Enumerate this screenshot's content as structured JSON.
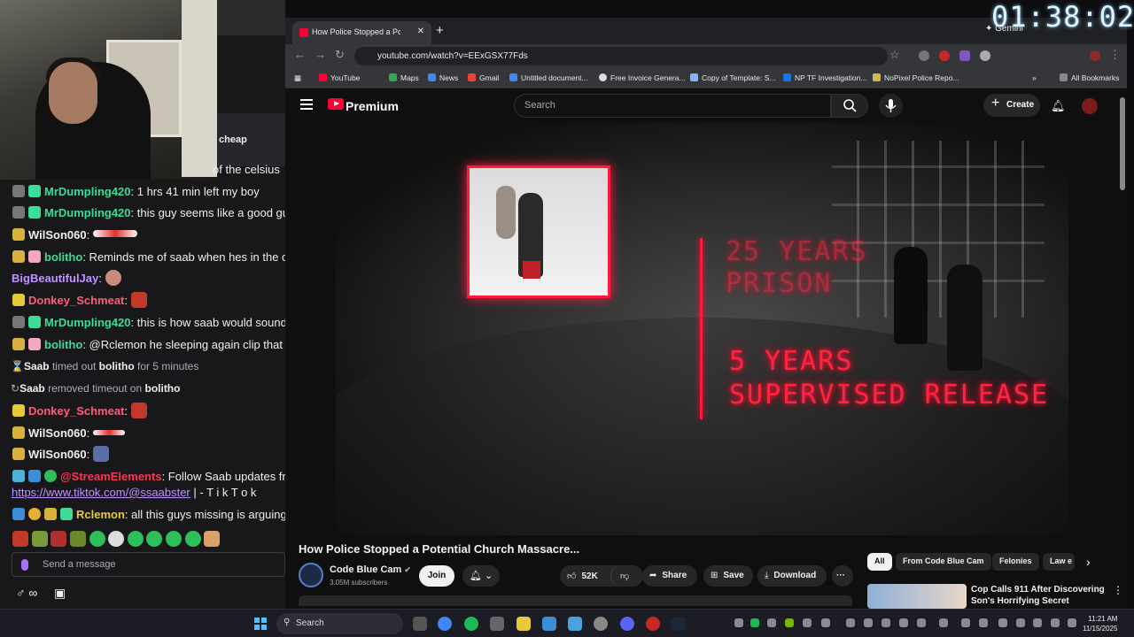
{
  "timer": "01:38:02",
  "chat": {
    "promo_text": "cheap",
    "messages": [
      {
        "user": "",
        "text": "of the celsius",
        "color": "#efeff1"
      },
      {
        "user": "MrDumpling420",
        "text": ": 1 hrs 41 min left my boy",
        "color": "#3ddc97"
      },
      {
        "user": "MrDumpling420",
        "text": ": this guy seems like a good gu",
        "color": "#3ddc97"
      },
      {
        "user": "WilSon060",
        "text": ":",
        "color": "#efeff1"
      },
      {
        "user": "bolitho",
        "text": ": Reminds me of saab when hes in the ca",
        "color": "#3ddc97"
      },
      {
        "user": "BigBeautifulJay",
        "text": ":",
        "color": "#bf94ff"
      },
      {
        "user": "Donkey_Schmeat",
        "text": ":",
        "color": "#ff5c7a"
      },
      {
        "user": "MrDumpling420",
        "text": ": this is how saab would sound",
        "color": "#3ddc97"
      },
      {
        "user": "bolitho",
        "text": ": @Rclemon he sleeping again clip that",
        "color": "#3ddc97"
      }
    ],
    "timeout": {
      "actor": "Saab",
      "mid": " timed out ",
      "target": "bolitho",
      "tail": " for 5 minutes"
    },
    "untimeout": {
      "actor": "Saab",
      "mid": " removed timeout on ",
      "target": "bolitho"
    },
    "messages2": [
      {
        "user": "Donkey_Schmeat",
        "text": ":",
        "color": "#ff5c7a"
      },
      {
        "user": "WilSon060",
        "text": ":",
        "color": "#efeff1"
      },
      {
        "user": "WilSon060",
        "text": ":",
        "color": "#efeff1"
      }
    ],
    "streamelements": {
      "user": "@StreamElements",
      "text": ": Follow Saab updates fro",
      "link": "https://www.tiktok.com/@ssaabster",
      "tail": " | - T i k T o k"
    },
    "rclemon": {
      "user": "Rclemon",
      "text": ": all this guys missing is arguing"
    },
    "input_placeholder": "Send a message",
    "footer_left": "♂ ∞",
    "footer_icon": "▣"
  },
  "browser": {
    "tab_title": "How Police Stopped a Potential Church Massacre...",
    "tab_close": "✕",
    "new_tab": "+",
    "gemini": "✦ Gemini",
    "url": "youtube.com/watch?v=EExGSX77Fds",
    "bookmarks": [
      {
        "label": "YouTube",
        "color": "#ff0033"
      },
      {
        "label": "Maps",
        "color": "#34a853"
      },
      {
        "label": "News",
        "color": "#4285f4"
      },
      {
        "label": "Gmail",
        "color": "#ea4335"
      },
      {
        "label": "Untitled document...",
        "color": "#4285f4"
      },
      {
        "label": "Free Invoice Genera...",
        "color": "#dddddd"
      },
      {
        "label": "Copy of Template: S...",
        "color": "#8ab4f8"
      },
      {
        "label": "NP TF Investigation...",
        "color": "#1a73e8"
      },
      {
        "label": "NoPixel Police Repo...",
        "color": "#d4b84a"
      }
    ],
    "all_bookmarks": "All Bookmarks"
  },
  "youtube": {
    "brand": "Premium",
    "search_placeholder": "Search",
    "create": "Create",
    "overlay": {
      "line1": "25 YEARS",
      "line2": "PRISON",
      "line3": "5 YEARS",
      "line4": "SUPERVISED RELEASE"
    },
    "title": "How Police Stopped a Potential Church Massacre...",
    "channel": "Code Blue Cam",
    "verified": "✔",
    "subscribers": "3.05M subscribers",
    "join": "Join",
    "likes": "52K",
    "share": "Share",
    "save": "Save",
    "download": "Download",
    "more": "···",
    "chips": [
      "All",
      "From Code Blue Cam",
      "Felonies",
      "Law e"
    ],
    "reco_title": "Cop Calls 911 After Discovering Son's Horrifying Secret"
  },
  "taskbar": {
    "search": "Search",
    "time": "11:21 AM",
    "date": "11/15/2025"
  }
}
